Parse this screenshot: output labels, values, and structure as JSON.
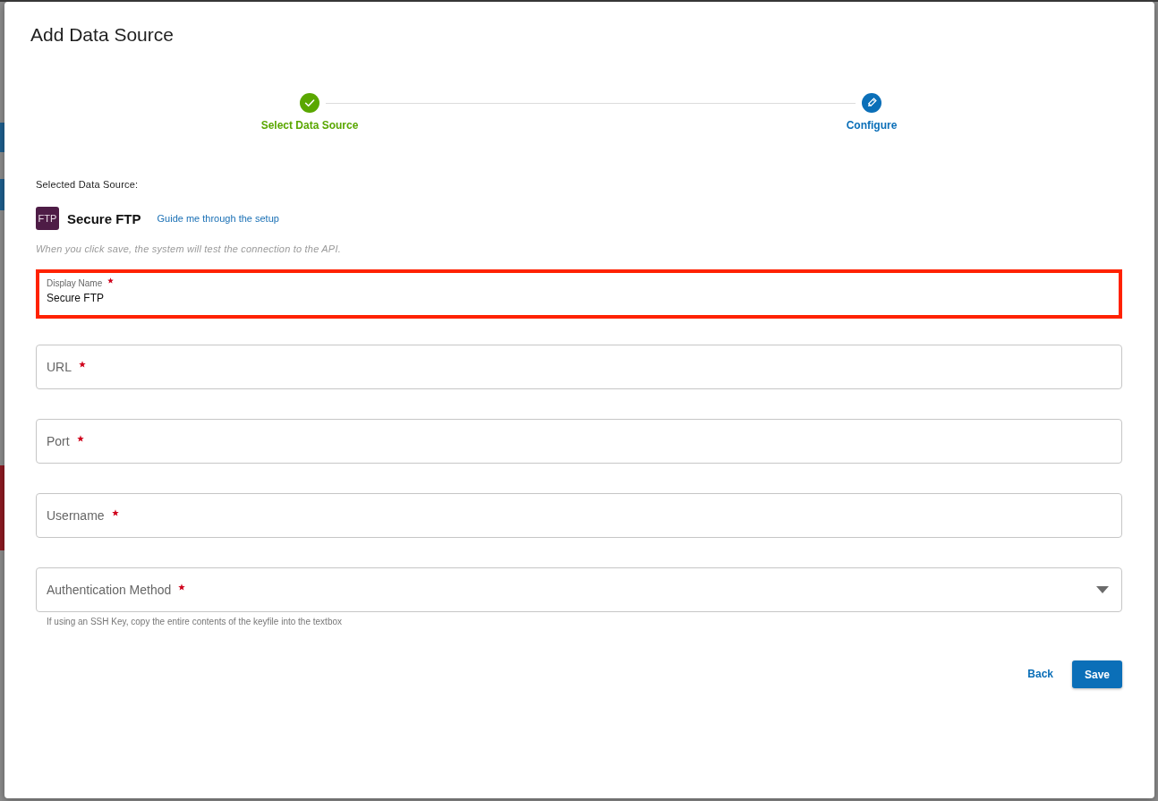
{
  "dialog": {
    "title": "Add Data Source"
  },
  "steps": [
    {
      "label": "Select Data Source",
      "completed": true,
      "selected": false
    },
    {
      "label": "Configure",
      "completed": false,
      "selected": true
    }
  ],
  "selected_source": {
    "heading": "Selected Data Source:",
    "logo_text": "FTP",
    "name": "Secure FTP",
    "guide_link": "Guide me through the setup",
    "note": "When you click save, the system will test the connection to the API."
  },
  "fields": [
    {
      "kind": "text",
      "label": "Display Name",
      "required": true,
      "value": "Secure FTP",
      "highlighted": true
    },
    {
      "kind": "text",
      "label": "URL",
      "required": true,
      "highlighted": false
    },
    {
      "kind": "text",
      "label": "Port",
      "required": true,
      "highlighted": false
    },
    {
      "kind": "text",
      "label": "Username",
      "required": true,
      "highlighted": false
    },
    {
      "kind": "select",
      "label": "Authentication Method",
      "required": true,
      "highlighted": false,
      "helper": "If using an SSH Key, copy the entire contents of the keyfile into the textbox"
    }
  ],
  "actions": [
    {
      "kind": "text",
      "label": "Back"
    },
    {
      "kind": "primary",
      "label": "Save"
    }
  ]
}
